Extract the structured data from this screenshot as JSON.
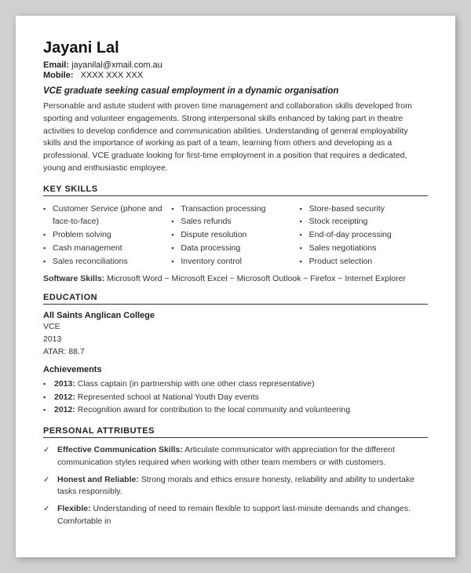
{
  "header": {
    "name": "Jayani Lal",
    "email_label": "Email:",
    "email_value": "jayanilal@xmail.com.au",
    "mobile_label": "Mobile:",
    "mobile_value": "XXXX XXX XXX",
    "tagline": "VCE graduate seeking casual employment in a dynamic organisation"
  },
  "summary": "Personable and astute student with proven time management and collaboration skills developed from sporting and volunteer engagements. Strong interpersonal skills enhanced by taking part in theatre activities to develop confidence and communication abilities. Understanding of general employability skills and the importance of working as part of a team, learning from others and developing as a professional. VCE graduate looking for first-time employment in a position that requires a dedicated, young and enthusiastic employee.",
  "sections": {
    "key_skills": {
      "title": "KEY SKILLS",
      "columns": [
        [
          "Customer Service (phone and face-to-face)",
          "Problem solving",
          "Cash management",
          "Sales reconciliations"
        ],
        [
          "Transaction processing",
          "Sales refunds",
          "Dispute resolution",
          "Data processing",
          "Inventory control"
        ],
        [
          "Store-based security",
          "Stock receipting",
          "End-of-day processing",
          "Sales negotiations",
          "Product selection"
        ]
      ],
      "software_label": "Software Skills:",
      "software_value": "Microsoft Word ~ Microsoft Excel ~ Microsoft Outlook ~ Firefox ~ Internet Explorer"
    },
    "education": {
      "title": "EDUCATION",
      "school": "All Saints Anglican College",
      "qualification": "VCE",
      "year": "2013",
      "atar_label": "ATAR:",
      "atar_value": "88.7",
      "achievements_title": "Achievements",
      "achievements": [
        {
          "year": "2013",
          "text": "Class captain (in partnership with one other class representative)"
        },
        {
          "year": "2012",
          "text": "Represented school at National Youth Day events"
        },
        {
          "year": "2012",
          "text": "Recognition award for contribution to the local community and volunteering"
        }
      ]
    },
    "personal_attributes": {
      "title": "PERSONAL ATTRIBUTES",
      "items": [
        {
          "label": "Effective Communication Skills:",
          "text": "Articulate communicator with appreciation for the different communication styles required when working with other team members or with customers."
        },
        {
          "label": "Honest and Reliable:",
          "text": "Strong morals and ethics ensure honesty, reliability and ability to undertake tasks responsibly."
        },
        {
          "label": "Flexible:",
          "text": "Understanding of need to remain flexible to support last-minute demands and changes. Comfortable in"
        }
      ]
    }
  }
}
